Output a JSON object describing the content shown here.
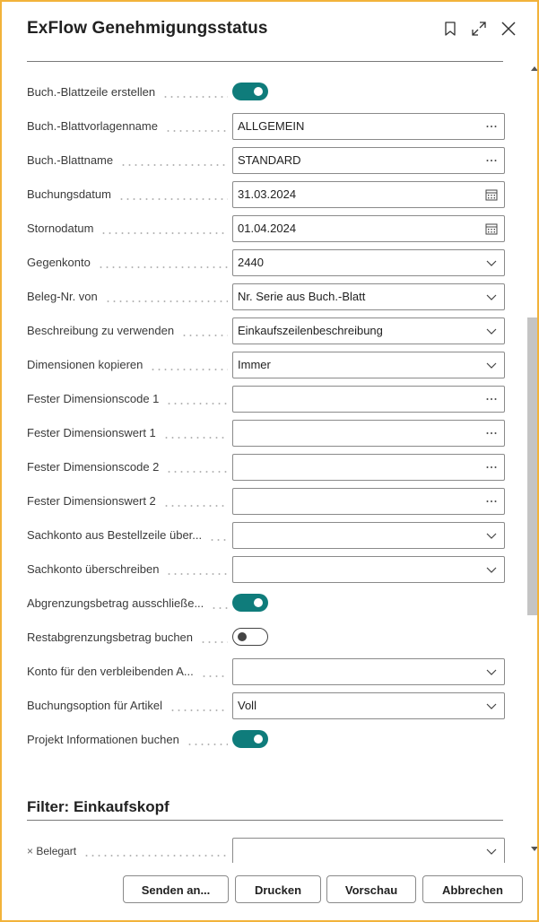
{
  "header": {
    "title": "ExFlow Genehmigungsstatus",
    "icons": [
      "bookmark-icon",
      "expand-icon",
      "close-icon"
    ]
  },
  "fields": [
    {
      "label": "Buch.-Blattzeile erstellen",
      "type": "toggle",
      "on": true
    },
    {
      "label": "Buch.-Blattvorlagenname",
      "type": "lookup",
      "value": "ALLGEMEIN"
    },
    {
      "label": "Buch.-Blattname",
      "type": "lookup",
      "value": "STANDARD"
    },
    {
      "label": "Buchungsdatum",
      "type": "date",
      "value": "31.03.2024"
    },
    {
      "label": "Stornodatum",
      "type": "date",
      "value": "01.04.2024"
    },
    {
      "label": "Gegenkonto",
      "type": "select",
      "value": "2440"
    },
    {
      "label": "Beleg-Nr. von",
      "type": "select",
      "value": "Nr. Serie aus Buch.-Blatt"
    },
    {
      "label": "Beschreibung zu verwenden",
      "type": "select",
      "value": "Einkaufszeilenbeschreibung"
    },
    {
      "label": "Dimensionen kopieren",
      "type": "select",
      "value": "Immer"
    },
    {
      "label": "Fester Dimensionscode 1",
      "type": "lookup",
      "value": ""
    },
    {
      "label": "Fester Dimensionswert 1",
      "type": "lookup",
      "value": ""
    },
    {
      "label": "Fester Dimensionscode 2",
      "type": "lookup",
      "value": ""
    },
    {
      "label": "Fester Dimensionswert 2",
      "type": "lookup",
      "value": ""
    },
    {
      "label": "Sachkonto aus Bestellzeile über...",
      "type": "select",
      "value": ""
    },
    {
      "label": "Sachkonto überschreiben",
      "type": "select",
      "value": ""
    },
    {
      "label": "Abgrenzungsbetrag ausschließe...",
      "type": "toggle",
      "on": true
    },
    {
      "label": "Restabgrenzungsbetrag buchen",
      "type": "toggle",
      "on": false
    },
    {
      "label": "Konto für den verbleibenden A...",
      "type": "select",
      "value": ""
    },
    {
      "label": "Buchungsoption für Artikel",
      "type": "select",
      "value": "Voll"
    },
    {
      "label": "Projekt Informationen buchen",
      "type": "toggle",
      "on": true
    }
  ],
  "filter_section": {
    "title": "Filter: Einkaufskopf",
    "field_label": "Belegart",
    "remove_glyph": "×"
  },
  "footer": {
    "send_label": "Senden an...",
    "print_label": "Drucken",
    "preview_label": "Vorschau",
    "cancel_label": "Abbrechen"
  },
  "colors": {
    "toggle_on": "#0f7c7b",
    "frame_border": "#f2b33a"
  }
}
